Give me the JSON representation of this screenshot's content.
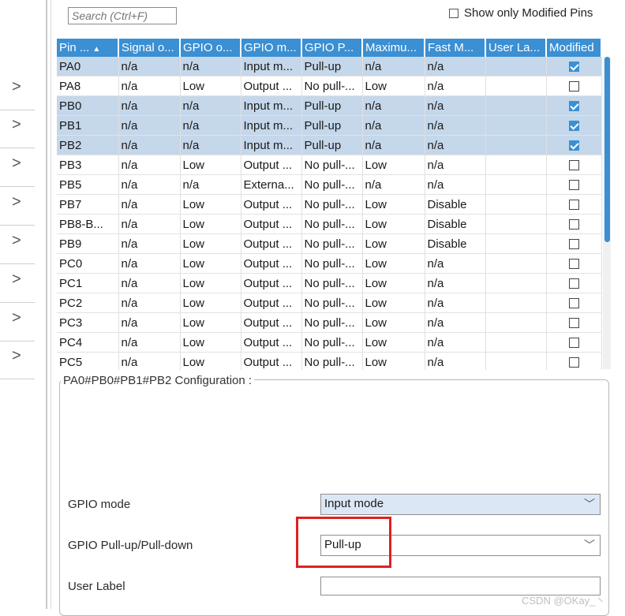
{
  "search": {
    "placeholder": "Search (Ctrl+F)"
  },
  "filter": {
    "show_modified_label": "Show only Modified Pins",
    "checked": false
  },
  "table": {
    "columns": [
      "Pin ...",
      "Signal o...",
      "GPIO o...",
      "GPIO m...",
      "GPIO P...",
      "Maximu...",
      "Fast M...",
      "User La...",
      "Modified"
    ],
    "rows": [
      {
        "pin": "PA0",
        "signal": "n/a",
        "output": "n/a",
        "mode": "Input m...",
        "pull": "Pull-up",
        "max": "n/a",
        "fast": "n/a",
        "label": "",
        "modified": true,
        "selected": true
      },
      {
        "pin": "PA8",
        "signal": "n/a",
        "output": "Low",
        "mode": "Output ...",
        "pull": "No pull-...",
        "max": "Low",
        "fast": "n/a",
        "label": "",
        "modified": false,
        "selected": false
      },
      {
        "pin": "PB0",
        "signal": "n/a",
        "output": "n/a",
        "mode": "Input m...",
        "pull": "Pull-up",
        "max": "n/a",
        "fast": "n/a",
        "label": "",
        "modified": true,
        "selected": true
      },
      {
        "pin": "PB1",
        "signal": "n/a",
        "output": "n/a",
        "mode": "Input m...",
        "pull": "Pull-up",
        "max": "n/a",
        "fast": "n/a",
        "label": "",
        "modified": true,
        "selected": true
      },
      {
        "pin": "PB2",
        "signal": "n/a",
        "output": "n/a",
        "mode": "Input m...",
        "pull": "Pull-up",
        "max": "n/a",
        "fast": "n/a",
        "label": "",
        "modified": true,
        "selected": true
      },
      {
        "pin": "PB3",
        "signal": "n/a",
        "output": "Low",
        "mode": "Output ...",
        "pull": "No pull-...",
        "max": "Low",
        "fast": "n/a",
        "label": "",
        "modified": false,
        "selected": false
      },
      {
        "pin": "PB5",
        "signal": "n/a",
        "output": "n/a",
        "mode": "Externa...",
        "pull": "No pull-...",
        "max": "n/a",
        "fast": "n/a",
        "label": "",
        "modified": false,
        "selected": false
      },
      {
        "pin": "PB7",
        "signal": "n/a",
        "output": "Low",
        "mode": "Output ...",
        "pull": "No pull-...",
        "max": "Low",
        "fast": "Disable",
        "label": "",
        "modified": false,
        "selected": false
      },
      {
        "pin": "PB8-B...",
        "signal": "n/a",
        "output": "Low",
        "mode": "Output ...",
        "pull": "No pull-...",
        "max": "Low",
        "fast": "Disable",
        "label": "",
        "modified": false,
        "selected": false
      },
      {
        "pin": "PB9",
        "signal": "n/a",
        "output": "Low",
        "mode": "Output ...",
        "pull": "No pull-...",
        "max": "Low",
        "fast": "Disable",
        "label": "",
        "modified": false,
        "selected": false
      },
      {
        "pin": "PC0",
        "signal": "n/a",
        "output": "Low",
        "mode": "Output ...",
        "pull": "No pull-...",
        "max": "Low",
        "fast": "n/a",
        "label": "",
        "modified": false,
        "selected": false
      },
      {
        "pin": "PC1",
        "signal": "n/a",
        "output": "Low",
        "mode": "Output ...",
        "pull": "No pull-...",
        "max": "Low",
        "fast": "n/a",
        "label": "",
        "modified": false,
        "selected": false
      },
      {
        "pin": "PC2",
        "signal": "n/a",
        "output": "Low",
        "mode": "Output ...",
        "pull": "No pull-...",
        "max": "Low",
        "fast": "n/a",
        "label": "",
        "modified": false,
        "selected": false
      },
      {
        "pin": "PC3",
        "signal": "n/a",
        "output": "Low",
        "mode": "Output ...",
        "pull": "No pull-...",
        "max": "Low",
        "fast": "n/a",
        "label": "",
        "modified": false,
        "selected": false
      },
      {
        "pin": "PC4",
        "signal": "n/a",
        "output": "Low",
        "mode": "Output ...",
        "pull": "No pull-...",
        "max": "Low",
        "fast": "n/a",
        "label": "",
        "modified": false,
        "selected": false
      },
      {
        "pin": "PC5",
        "signal": "n/a",
        "output": "Low",
        "mode": "Output ...",
        "pull": "No pull-...",
        "max": "Low",
        "fast": "n/a",
        "label": "",
        "modified": false,
        "selected": false
      }
    ]
  },
  "config": {
    "title": "PA0#PB0#PB1#PB2 Configuration :",
    "gpio_mode_label": "GPIO mode",
    "gpio_mode_value": "Input mode",
    "pull_label": "GPIO Pull-up/Pull-down",
    "pull_value": "Pull-up",
    "user_label_label": "User Label",
    "user_label_value": ""
  },
  "left_nav": {
    "items": [
      ">",
      ">",
      ">",
      ">",
      ">",
      ">",
      ">",
      ">"
    ],
    "icon": "chevron-right-icon"
  },
  "colors": {
    "header": "#3b8fd3",
    "selected_row": "#c5d7ea",
    "highlight_box": "#e02020"
  },
  "watermark": "CSDN @OKay_丶"
}
